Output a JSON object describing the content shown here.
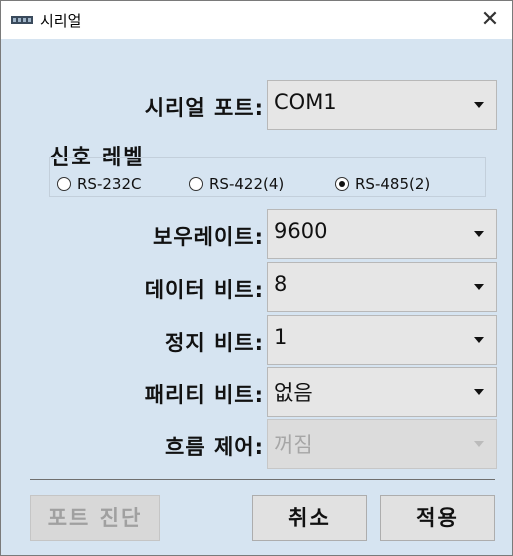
{
  "window": {
    "title": "시리얼",
    "close_label": "✕"
  },
  "fields": {
    "serial_port": {
      "label": "시리얼 포트:",
      "value": "COM1"
    },
    "baud_rate": {
      "label": "보우레이트:",
      "value": "9600"
    },
    "data_bits": {
      "label": "데이터 비트:",
      "value": "8"
    },
    "stop_bits": {
      "label": "정지 비트:",
      "value": "1"
    },
    "parity": {
      "label": "패리티 비트:",
      "value": "없음"
    },
    "flow_control": {
      "label": "흐름 제어:",
      "value": "꺼짐",
      "disabled": true
    }
  },
  "signal_level": {
    "title": "신호 레벨",
    "options": [
      {
        "label": "RS-232C",
        "checked": false
      },
      {
        "label": "RS-422(4)",
        "checked": false
      },
      {
        "label": "RS-485(2)",
        "checked": true
      }
    ]
  },
  "buttons": {
    "port_diagnostics": {
      "label": "포트 진단",
      "disabled": true
    },
    "cancel": {
      "label": "취소"
    },
    "apply": {
      "label": "적용"
    }
  }
}
